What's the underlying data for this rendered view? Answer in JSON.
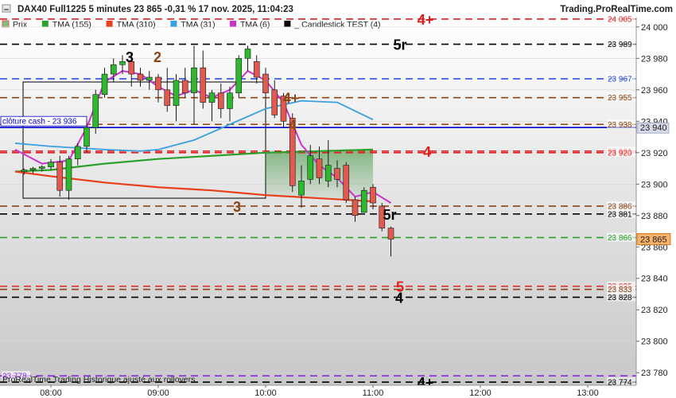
{
  "header": {
    "title": "DAX40 Full1225 5 minutes 23 865 -0,31 % 17 nov. 2025, 11:04:23",
    "brand": "Trading.ProRealTime.com",
    "minimize_icon": "minimize-icon"
  },
  "legend": [
    {
      "label": "Prix",
      "color": "#7fbf7f",
      "icon": "price-swatch"
    },
    {
      "label": "TMA (155)",
      "color": "#2ca02c"
    },
    {
      "label": "TMA (310)",
      "color": "#e8401c"
    },
    {
      "label": "TMA (31)",
      "color": "#3aa0e0"
    },
    {
      "label": "TMA (6)",
      "color": "#cc33cc"
    },
    {
      "label": "_ Candlestick TEST (4)",
      "color": "#000000"
    }
  ],
  "footer": {
    "text": "ProRealTime Trading  Historique ajusté aux rollovers"
  },
  "colors": {
    "up": "#2db82d",
    "down": "#e05a50",
    "background_top": "#ffffff",
    "background_bottom": "#c8c8c8"
  },
  "chart_data": {
    "type": "candlestick",
    "x_ticks": [
      "08:00",
      "09:00",
      "10:00",
      "11:00",
      "12:00",
      "13:00"
    ],
    "y_ticks": [
      "24 000",
      "23 980",
      "23 960",
      "23 940",
      "23 920",
      "23 900",
      "23 880",
      "23 860",
      "23 840",
      "23 820",
      "23 800",
      "23 780"
    ],
    "ylim": [
      23772,
      24006
    ],
    "candles": [
      {
        "t": "07:45",
        "o": 23908,
        "h": 23910,
        "l": 23906,
        "c": 23909
      },
      {
        "t": "07:50",
        "o": 23909,
        "h": 23911,
        "l": 23907,
        "c": 23910
      },
      {
        "t": "07:55",
        "o": 23910,
        "h": 23912,
        "l": 23908,
        "c": 23911
      },
      {
        "t": "08:00",
        "o": 23911,
        "h": 23916,
        "l": 23909,
        "c": 23914
      },
      {
        "t": "08:05",
        "o": 23914,
        "h": 23918,
        "l": 23892,
        "c": 23896
      },
      {
        "t": "08:10",
        "o": 23896,
        "h": 23918,
        "l": 23890,
        "c": 23916
      },
      {
        "t": "08:15",
        "o": 23916,
        "h": 23926,
        "l": 23912,
        "c": 23924
      },
      {
        "t": "08:20",
        "o": 23924,
        "h": 23940,
        "l": 23920,
        "c": 23936
      },
      {
        "t": "08:25",
        "o": 23936,
        "h": 23960,
        "l": 23932,
        "c": 23957
      },
      {
        "t": "08:30",
        "o": 23957,
        "h": 23974,
        "l": 23955,
        "c": 23970
      },
      {
        "t": "08:35",
        "o": 23970,
        "h": 23980,
        "l": 23965,
        "c": 23976
      },
      {
        "t": "08:40",
        "o": 23976,
        "h": 23982,
        "l": 23970,
        "c": 23978
      },
      {
        "t": "08:45",
        "o": 23978,
        "h": 23982,
        "l": 23962,
        "c": 23970
      },
      {
        "t": "08:50",
        "o": 23970,
        "h": 23974,
        "l": 23962,
        "c": 23966
      },
      {
        "t": "08:55",
        "o": 23966,
        "h": 23972,
        "l": 23960,
        "c": 23968
      },
      {
        "t": "09:00",
        "o": 23968,
        "h": 23970,
        "l": 23952,
        "c": 23960
      },
      {
        "t": "09:05",
        "o": 23960,
        "h": 23974,
        "l": 23946,
        "c": 23950
      },
      {
        "t": "09:10",
        "o": 23950,
        "h": 23970,
        "l": 23940,
        "c": 23966
      },
      {
        "t": "09:15",
        "o": 23966,
        "h": 23974,
        "l": 23955,
        "c": 23958
      },
      {
        "t": "09:20",
        "o": 23958,
        "h": 23988,
        "l": 23938,
        "c": 23974
      },
      {
        "t": "09:25",
        "o": 23974,
        "h": 23985,
        "l": 23948,
        "c": 23952
      },
      {
        "t": "09:30",
        "o": 23952,
        "h": 23960,
        "l": 23940,
        "c": 23958
      },
      {
        "t": "09:35",
        "o": 23958,
        "h": 23964,
        "l": 23942,
        "c": 23948
      },
      {
        "t": "09:40",
        "o": 23948,
        "h": 23962,
        "l": 23940,
        "c": 23958
      },
      {
        "t": "09:45",
        "o": 23958,
        "h": 23982,
        "l": 23955,
        "c": 23980
      },
      {
        "t": "09:50",
        "o": 23980,
        "h": 23988,
        "l": 23972,
        "c": 23986
      },
      {
        "t": "09:55",
        "o": 23978,
        "h": 23982,
        "l": 23964,
        "c": 23968
      },
      {
        "t": "10:00",
        "o": 23970,
        "h": 23974,
        "l": 23952,
        "c": 23958
      },
      {
        "t": "10:05",
        "o": 23960,
        "h": 23966,
        "l": 23942,
        "c": 23944
      },
      {
        "t": "10:10",
        "o": 23956,
        "h": 23958,
        "l": 23936,
        "c": 23940
      },
      {
        "t": "10:15",
        "o": 23942,
        "h": 23945,
        "l": 23895,
        "c": 23899
      },
      {
        "t": "10:20",
        "o": 23893,
        "h": 23912,
        "l": 23885,
        "c": 23902
      },
      {
        "t": "10:25",
        "o": 23903,
        "h": 23925,
        "l": 23900,
        "c": 23918
      },
      {
        "t": "10:30",
        "o": 23916,
        "h": 23924,
        "l": 23900,
        "c": 23904
      },
      {
        "t": "10:35",
        "o": 23902,
        "h": 23928,
        "l": 23898,
        "c": 23912
      },
      {
        "t": "10:40",
        "o": 23910,
        "h": 23915,
        "l": 23898,
        "c": 23903
      },
      {
        "t": "10:45",
        "o": 23912,
        "h": 23914,
        "l": 23888,
        "c": 23890
      },
      {
        "t": "10:50",
        "o": 23890,
        "h": 23892,
        "l": 23876,
        "c": 23880
      },
      {
        "t": "10:55",
        "o": 23882,
        "h": 23898,
        "l": 23882,
        "c": 23896
      },
      {
        "t": "11:00",
        "o": 23898,
        "h": 23900,
        "l": 23884,
        "c": 23888
      },
      {
        "t": "11:05",
        "o": 23886,
        "h": 23888,
        "l": 23870,
        "c": 23872
      },
      {
        "t": "11:10",
        "o": 23872,
        "h": 23873,
        "l": 23854,
        "c": 23865
      }
    ],
    "series": [
      {
        "name": "TMA (155)",
        "color": "#2ca02c",
        "points": [
          [
            "07:40",
            23908
          ],
          [
            "08:00",
            23909
          ],
          [
            "08:30",
            23913
          ],
          [
            "09:00",
            23916
          ],
          [
            "09:30",
            23918
          ],
          [
            "10:00",
            23920
          ],
          [
            "10:30",
            23921
          ],
          [
            "11:00",
            23922
          ]
        ]
      },
      {
        "name": "TMA (310)",
        "color": "#e8401c",
        "points": [
          [
            "07:40",
            23908
          ],
          [
            "08:00",
            23905
          ],
          [
            "08:30",
            23901
          ],
          [
            "09:00",
            23898
          ],
          [
            "09:30",
            23896
          ],
          [
            "10:00",
            23893
          ],
          [
            "10:30",
            23891
          ],
          [
            "11:00",
            23889
          ]
        ]
      },
      {
        "name": "TMA (31)",
        "color": "#3aa0e0",
        "points": [
          [
            "07:40",
            23926
          ],
          [
            "08:00",
            23924
          ],
          [
            "08:30",
            23922
          ],
          [
            "08:50",
            23921
          ],
          [
            "09:00",
            23922
          ],
          [
            "09:20",
            23928
          ],
          [
            "09:40",
            23938
          ],
          [
            "10:00",
            23948
          ],
          [
            "10:20",
            23953
          ],
          [
            "10:40",
            23952
          ],
          [
            "11:00",
            23941
          ]
        ]
      },
      {
        "name": "TMA (6)",
        "color": "#cc33cc",
        "points": [
          [
            "07:40",
            23922
          ],
          [
            "07:55",
            23913
          ],
          [
            "08:10",
            23915
          ],
          [
            "08:20",
            23936
          ],
          [
            "08:30",
            23965
          ],
          [
            "08:40",
            23972
          ],
          [
            "08:50",
            23970
          ],
          [
            "09:00",
            23962
          ],
          [
            "09:10",
            23956
          ],
          [
            "09:20",
            23960
          ],
          [
            "09:30",
            23955
          ],
          [
            "09:40",
            23960
          ],
          [
            "09:50",
            23972
          ],
          [
            "10:00",
            23966
          ],
          [
            "10:10",
            23952
          ],
          [
            "10:20",
            23925
          ],
          [
            "10:30",
            23912
          ],
          [
            "10:40",
            23904
          ],
          [
            "10:50",
            23892
          ],
          [
            "11:00",
            23895
          ],
          [
            "11:10",
            23888
          ]
        ]
      }
    ],
    "lines": [
      {
        "price": 24005,
        "color": "#e02020",
        "label": "24 005",
        "pivot": "4+"
      },
      {
        "price": 23989,
        "color": "#000000",
        "label": "23 989",
        "pivot": "5r"
      },
      {
        "price": 23967,
        "color": "#2040e0",
        "label": "23 967",
        "pivot": ""
      },
      {
        "price": 23955,
        "color": "#8b4513",
        "label": "23 955",
        "pivot": "4+"
      },
      {
        "price": 23938,
        "color": "#8b4513",
        "label": "23 938",
        "pivot": "4"
      },
      {
        "price": 23921,
        "color": "#e02020",
        "label": "23 921",
        "pivot": "4"
      },
      {
        "price": 23920,
        "color": "#e02020",
        "label": "23 920",
        "pivot": ""
      },
      {
        "price": 23886,
        "color": "#8b4513",
        "label": "23 886",
        "pivot": "3"
      },
      {
        "price": 23881,
        "color": "#000000",
        "label": "23 881",
        "pivot": "5r"
      },
      {
        "price": 23866,
        "color": "#2ca02c",
        "label": "23 866",
        "pivot": ""
      },
      {
        "price": 23835,
        "color": "#e02020",
        "label": "23 835",
        "pivot": "5"
      },
      {
        "price": 23833,
        "color": "#8b4513",
        "label": "23 833",
        "pivot": ""
      },
      {
        "price": 23828,
        "color": "#000000",
        "label": "23 828",
        "pivot": "4"
      },
      {
        "price": 23778,
        "color": "#8a2be2",
        "label": "23 778",
        "pivot": ""
      },
      {
        "price": 23774,
        "color": "#000000",
        "label": "23 774",
        "pivot": "4+"
      }
    ],
    "pivot_top": [
      {
        "text": "3",
        "color": "#000000"
      },
      {
        "text": "2",
        "color": "#8b4513"
      }
    ],
    "close_cash": {
      "label": "clôture cash -  23 936",
      "price": 23936,
      "axis_label": "23 940",
      "color": "#0000cc"
    },
    "last_price": {
      "label": "23 865",
      "price": 23865,
      "color": "#cc6600"
    }
  }
}
